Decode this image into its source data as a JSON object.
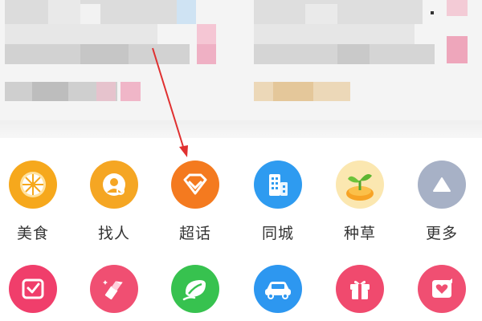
{
  "grid": {
    "row1": [
      {
        "label": "美食",
        "icon": "orange-slice-icon",
        "color": "#F6A81C"
      },
      {
        "label": "找人",
        "icon": "find-person-icon",
        "color": "#F5A623"
      },
      {
        "label": "超话",
        "icon": "diamond-icon",
        "color": "#F47A1F"
      },
      {
        "label": "同城",
        "icon": "city-building-icon",
        "color": "#2E9BF0"
      },
      {
        "label": "种草",
        "icon": "sprout-icon",
        "color": "#F7B731"
      },
      {
        "label": "更多",
        "icon": "triangle-up-icon",
        "color": "#A7B1C6"
      }
    ],
    "row2": [
      {
        "icon": "check-box-icon",
        "color": "#F03E6B"
      },
      {
        "icon": "lipstick-icon",
        "color": "#F04F72"
      },
      {
        "icon": "leaf-icon",
        "color": "#37C24F"
      },
      {
        "icon": "car-icon",
        "color": "#2D97F0"
      },
      {
        "icon": "gift-icon",
        "color": "#F04A6E"
      },
      {
        "icon": "heart-card-icon",
        "color": "#F04F72"
      }
    ]
  },
  "colors": {
    "annotation_arrow": "#E03030"
  }
}
